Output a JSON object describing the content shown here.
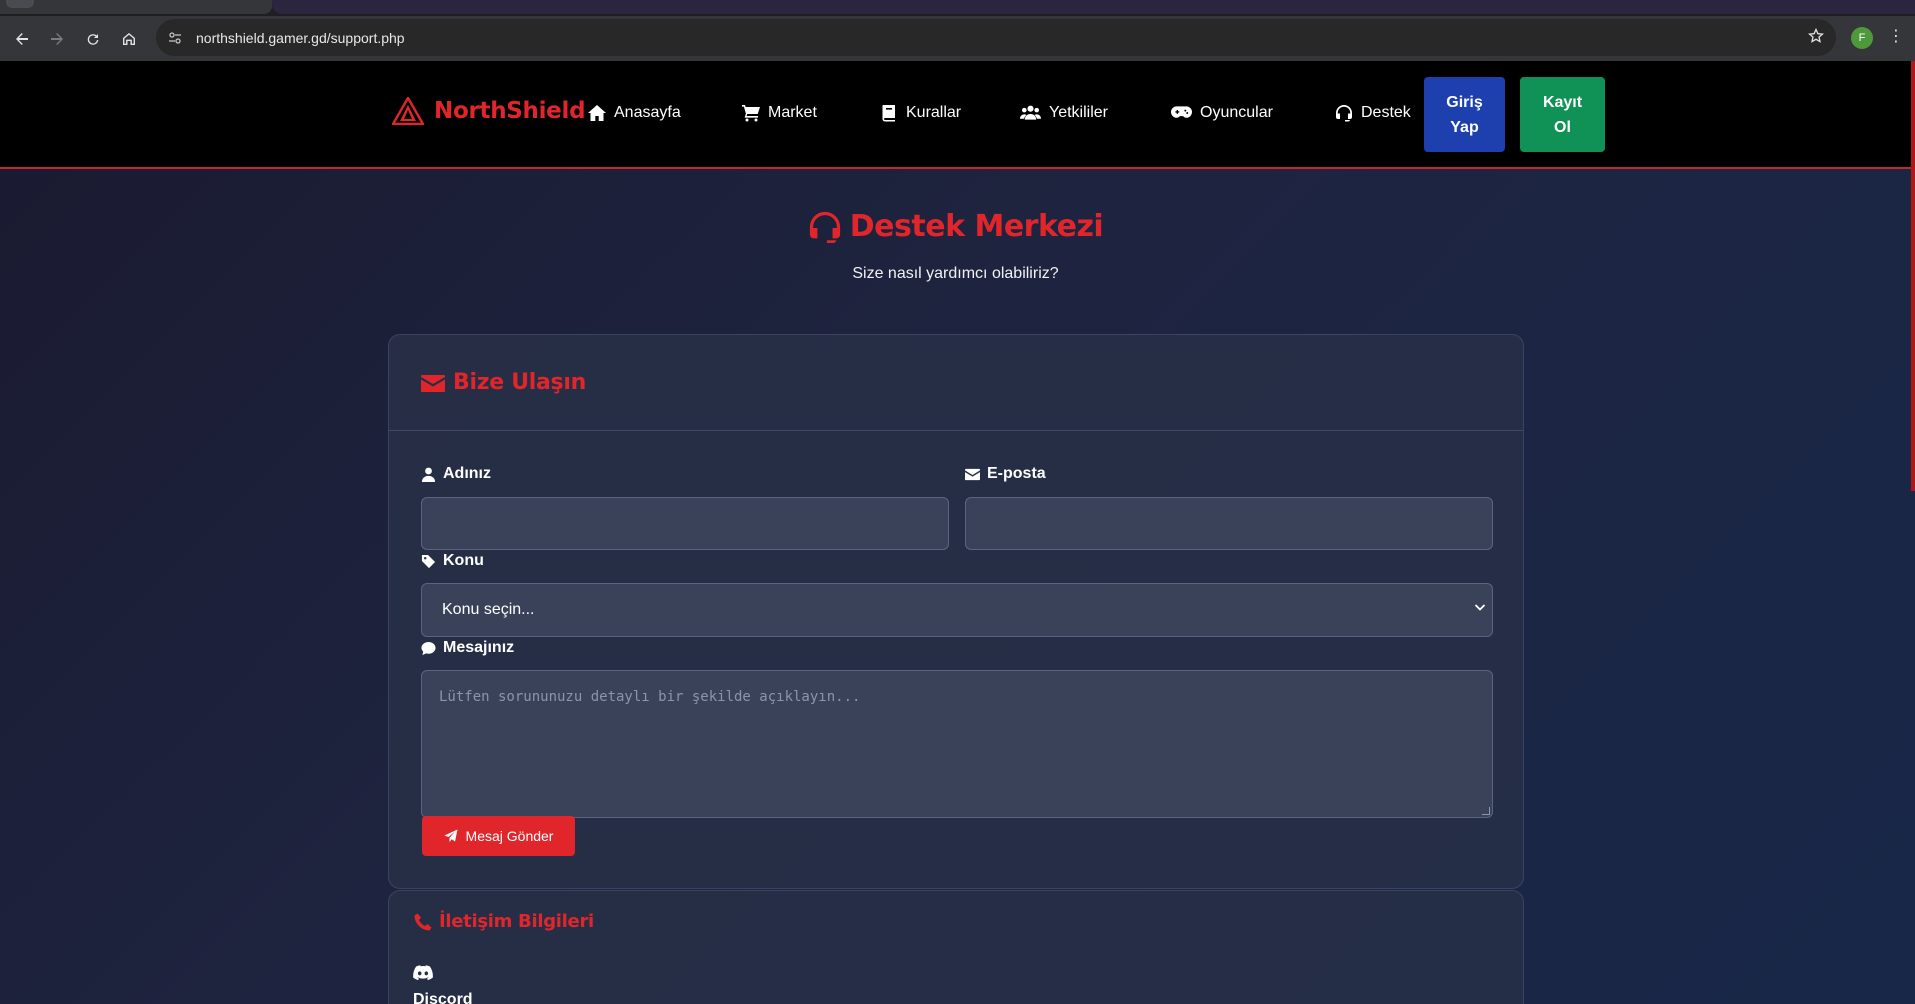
{
  "browser": {
    "url": "northshield.gamer.gd/support.php",
    "profile_initial": "F"
  },
  "nav": {
    "brand": "NorthShield",
    "items": [
      {
        "label": "Anasayfa",
        "icon": "home-icon"
      },
      {
        "label": "Market",
        "icon": "cart-icon"
      },
      {
        "label": "Kurallar",
        "icon": "book-icon"
      },
      {
        "label": "Yetkililer",
        "icon": "users-icon"
      },
      {
        "label": "Oyuncular",
        "icon": "gamepad-icon"
      },
      {
        "label": "Destek",
        "icon": "headset-icon"
      }
    ],
    "login_line1": "Giriş",
    "login_line2": "Yap",
    "register_line1": "Kayıt",
    "register_line2": "Ol"
  },
  "hero": {
    "title": "Destek Merkezi",
    "subtitle": "Size nasıl yardımcı olabiliriz?"
  },
  "contact_form": {
    "title": "Bize Ulaşın",
    "name_label": "Adınız",
    "name_value": "",
    "email_label": "E-posta",
    "email_value": "",
    "subject_label": "Konu",
    "subject_selected": "Konu seçin...",
    "message_label": "Mesajınız",
    "message_placeholder": "Lütfen sorununuzu detaylı bir şekilde açıklayın...",
    "submit_label": "Mesaj Gönder"
  },
  "contact_info": {
    "title": "İletişim Bilgileri",
    "discord_label": "Discord"
  },
  "colors": {
    "accent": "#e0262b",
    "login": "#1e40af",
    "register": "#109257",
    "navbar": "#000000"
  }
}
